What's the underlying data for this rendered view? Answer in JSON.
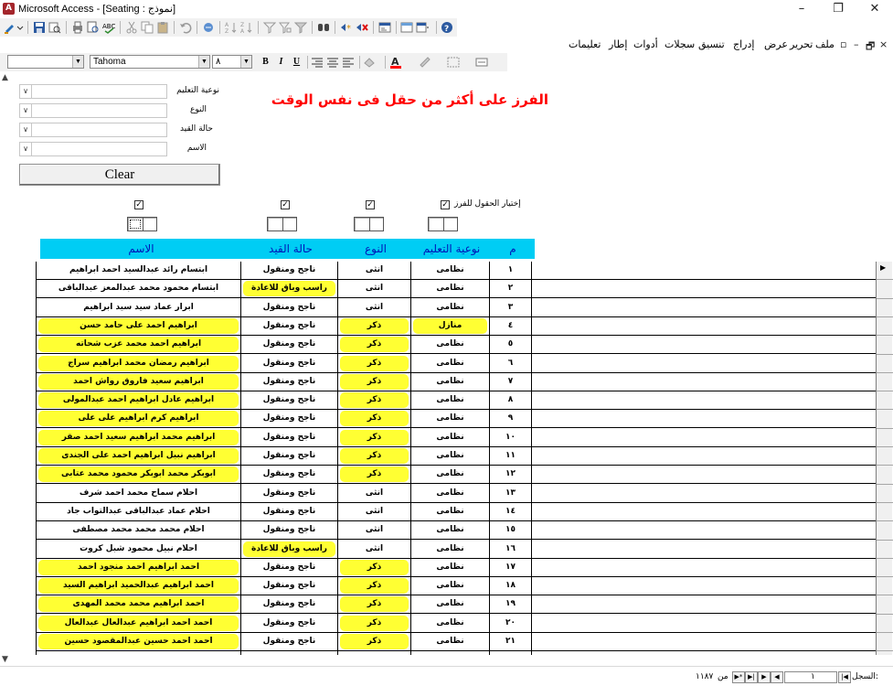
{
  "window": {
    "title": "Microsoft Access - [Seating : نموذج]",
    "minimize": "–",
    "maximize": "❐",
    "close": "✕"
  },
  "menu": {
    "items": [
      "ملف",
      "تحرير",
      "عرض",
      "إدراج",
      "تنسيق",
      "سجلات",
      "أدوات",
      "إطار",
      "تعليمات"
    ]
  },
  "format_toolbar": {
    "font_name": "Tahoma",
    "font_size": "٨",
    "bold": "B",
    "italic": "I",
    "underline": "U"
  },
  "filters": [
    {
      "label": "نوعية التعليم",
      "value": ""
    },
    {
      "label": "النوع",
      "value": ""
    },
    {
      "label": "حالة القيد",
      "value": ""
    },
    {
      "label": "الاسم",
      "value": ""
    }
  ],
  "clear_label": "Clear",
  "headline": "الفرز على أكثر من حقل فى نفس الوقت",
  "choose_label": "إختيار الحقول للفرز",
  "headers": {
    "num": "م",
    "edu": "نوعية التعليم",
    "gender": "النوع",
    "status": "حالة القيد",
    "name": "الاسم"
  },
  "rows": [
    {
      "num": "١",
      "edu": "نظامى",
      "gender": "انثى",
      "status": "ناجح ومنقول",
      "name": "ابتسام رائد عبدالسيد احمد ابراهيم",
      "hl": []
    },
    {
      "num": "٢",
      "edu": "نظامى",
      "gender": "انثى",
      "status": "راسب وباق للاعادة",
      "name": "ابتسام محمود محمد عبدالمعز عبدالباقى",
      "hl": [
        "status"
      ]
    },
    {
      "num": "٣",
      "edu": "نظامى",
      "gender": "انثى",
      "status": "ناجح ومنقول",
      "name": "ابرار عماد سيد سيد ابراهيم",
      "hl": []
    },
    {
      "num": "٤",
      "edu": "منازل",
      "gender": "ذكر",
      "status": "ناجح ومنقول",
      "name": "ابراهيم احمد على حامد حسن",
      "hl": [
        "edu",
        "gender",
        "name"
      ]
    },
    {
      "num": "٥",
      "edu": "نظامى",
      "gender": "ذكر",
      "status": "ناجح ومنقول",
      "name": "ابراهيم احمد محمد عزب شحاته",
      "hl": [
        "gender",
        "name"
      ]
    },
    {
      "num": "٦",
      "edu": "نظامى",
      "gender": "ذكر",
      "status": "ناجح ومنقول",
      "name": "ابراهيم رمضان محمد ابراهيم سراج",
      "hl": [
        "gender",
        "name"
      ]
    },
    {
      "num": "٧",
      "edu": "نظامى",
      "gender": "ذكر",
      "status": "ناجح ومنقول",
      "name": "ابراهيم سعيد فاروق رواش احمد",
      "hl": [
        "gender",
        "name"
      ]
    },
    {
      "num": "٨",
      "edu": "نظامى",
      "gender": "ذكر",
      "status": "ناجح ومنقول",
      "name": "ابراهيم عادل ابراهيم احمد عبدالمولى",
      "hl": [
        "gender",
        "name"
      ]
    },
    {
      "num": "٩",
      "edu": "نظامى",
      "gender": "ذكر",
      "status": "ناجح ومنقول",
      "name": "ابراهيم كرم ابراهيم على على",
      "hl": [
        "gender",
        "name"
      ]
    },
    {
      "num": "١٠",
      "edu": "نظامى",
      "gender": "ذكر",
      "status": "ناجح ومنقول",
      "name": "ابراهيم محمد ابراهيم سعيد احمد صقر",
      "hl": [
        "gender",
        "name"
      ]
    },
    {
      "num": "١١",
      "edu": "نظامى",
      "gender": "ذكر",
      "status": "ناجح ومنقول",
      "name": "ابراهيم نبيل ابراهيم احمد على الجندى",
      "hl": [
        "gender",
        "name"
      ]
    },
    {
      "num": "١٢",
      "edu": "نظامى",
      "gender": "ذكر",
      "status": "ناجح ومنقول",
      "name": "ابوبكر محمد ابوبكر محمود محمد عتابى",
      "hl": [
        "gender",
        "name"
      ]
    },
    {
      "num": "١٣",
      "edu": "نظامى",
      "gender": "انثى",
      "status": "ناجح ومنقول",
      "name": "احلام سماح محمد احمد شرف",
      "hl": []
    },
    {
      "num": "١٤",
      "edu": "نظامى",
      "gender": "انثى",
      "status": "ناجح ومنقول",
      "name": "احلام عماد عبدالباقى عبدالتواب جاد",
      "hl": []
    },
    {
      "num": "١٥",
      "edu": "نظامى",
      "gender": "انثى",
      "status": "ناجح ومنقول",
      "name": "احلام محمد محمد محمد مصطفى",
      "hl": []
    },
    {
      "num": "١٦",
      "edu": "نظامى",
      "gender": "انثى",
      "status": "راسب وباق للاعادة",
      "name": "احلام نبيل محمود شبل كروت",
      "hl": [
        "status"
      ]
    },
    {
      "num": "١٧",
      "edu": "نظامى",
      "gender": "ذكر",
      "status": "ناجح ومنقول",
      "name": "احمد ابراهيم احمد منجود احمد",
      "hl": [
        "gender",
        "name"
      ]
    },
    {
      "num": "١٨",
      "edu": "نظامى",
      "gender": "ذكر",
      "status": "ناجح ومنقول",
      "name": "احمد ابراهيم عبدالحميد ابراهيم السيد",
      "hl": [
        "gender",
        "name"
      ]
    },
    {
      "num": "١٩",
      "edu": "نظامى",
      "gender": "ذكر",
      "status": "ناجح ومنقول",
      "name": "احمد ابراهيم محمد محمد المهدى",
      "hl": [
        "gender",
        "name"
      ]
    },
    {
      "num": "٢٠",
      "edu": "نظامى",
      "gender": "ذكر",
      "status": "ناجح ومنقول",
      "name": "احمد احمد ابراهيم عبدالعال عبدالعال",
      "hl": [
        "gender",
        "name"
      ]
    },
    {
      "num": "٢١",
      "edu": "نظامى",
      "gender": "ذكر",
      "status": "ناجح ومنقول",
      "name": "احمد احمد حسين عبدالمقصود حسين",
      "hl": [
        "gender",
        "name"
      ]
    }
  ],
  "nav": {
    "record_label": "السجل:",
    "current": "١",
    "of_label": "من",
    "total": "١١٨٧"
  },
  "colors": {
    "header_band": "#00cdf4",
    "header_text": "#0015b8",
    "highlight": "#ffff33",
    "headline": "#ff0000"
  }
}
